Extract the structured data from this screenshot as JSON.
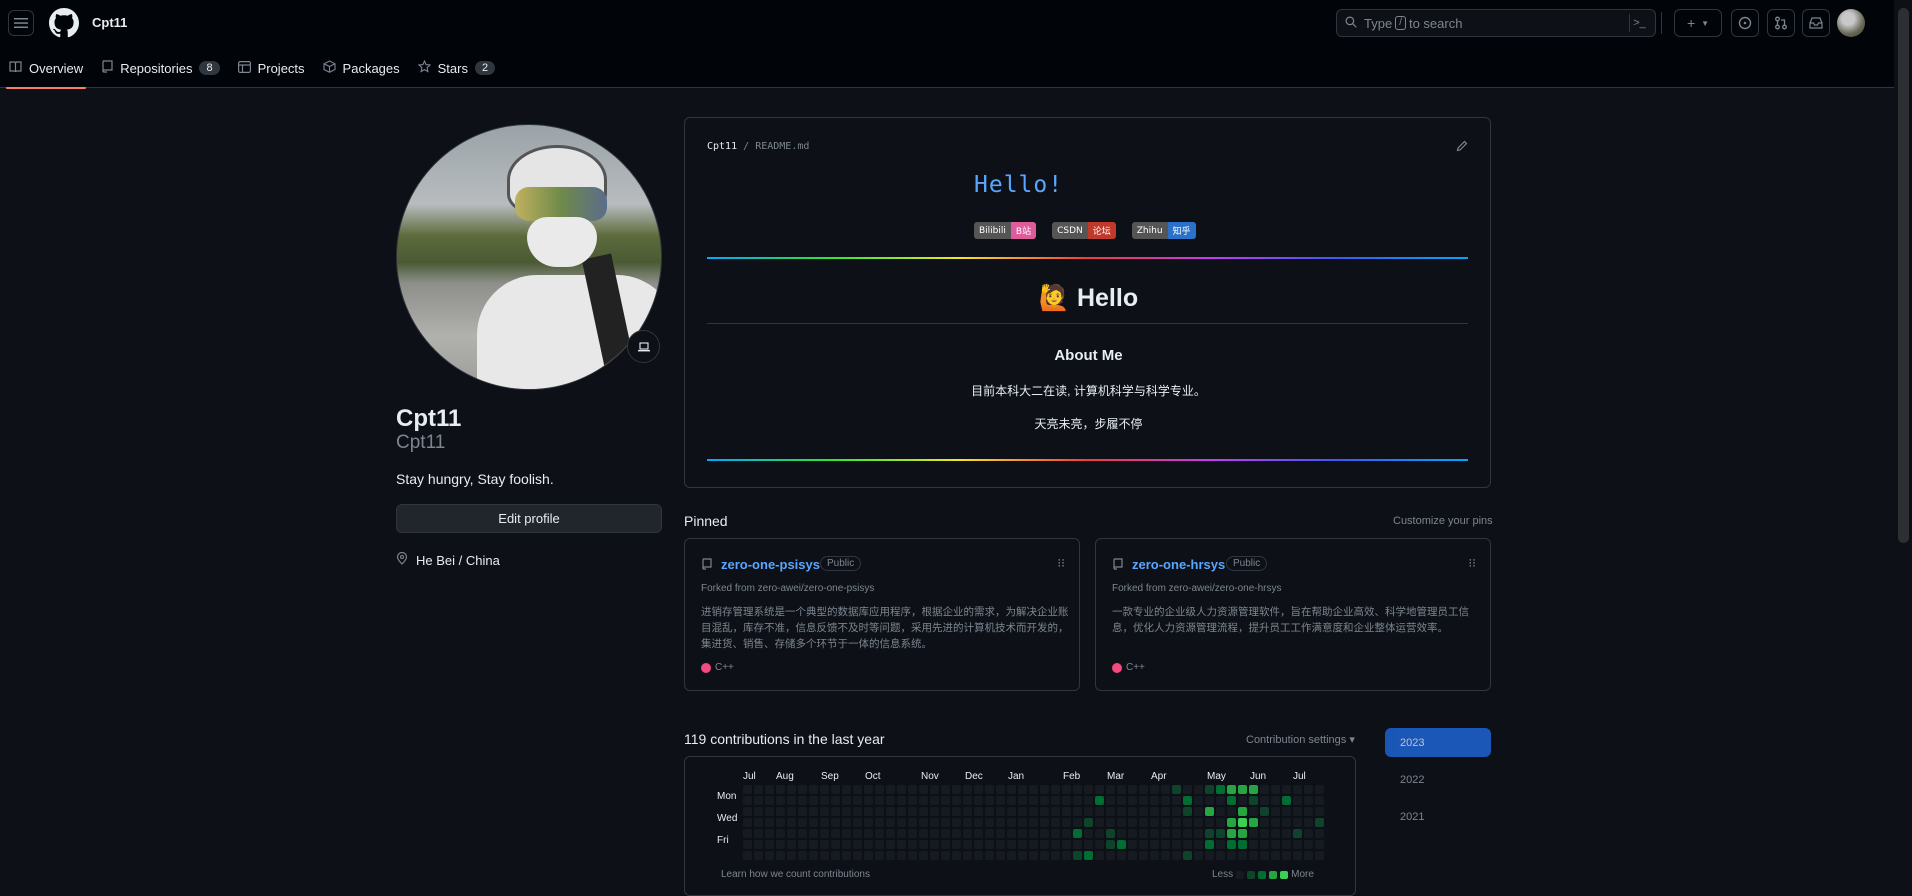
{
  "topbar": {
    "username": "Cpt11",
    "search_prefix": "Type",
    "search_key": "/",
    "search_suffix": "to search",
    "new_label": "+"
  },
  "nav": {
    "tabs": [
      {
        "label": "Overview",
        "icon": "book-icon",
        "active": true
      },
      {
        "label": "Repositories",
        "icon": "repo-icon",
        "count": "8"
      },
      {
        "label": "Projects",
        "icon": "table-icon"
      },
      {
        "label": "Packages",
        "icon": "package-icon"
      },
      {
        "label": "Stars",
        "icon": "star-icon",
        "count": "2"
      }
    ]
  },
  "profile": {
    "name": "Cpt11",
    "login": "Cpt11",
    "bio": "Stay hungry, Stay foolish.",
    "edit_label": "Edit profile",
    "location": "He Bei / China"
  },
  "readme": {
    "owner": "Cpt11",
    "sep": "/",
    "file": "README.md",
    "hello_mono": "Hello!",
    "badges": [
      {
        "left": "Bilibili",
        "right": "B站",
        "color": "#e05b9c"
      },
      {
        "left": "CSDN",
        "right": "论坛",
        "color": "#c0392b"
      },
      {
        "left": "Zhihu",
        "right": "知乎",
        "color": "#2a72c9"
      }
    ],
    "heading": "🙋 Hello",
    "about_title": "About Me",
    "about_line1": "目前本科大二在读, 计算机科学与科学专业。",
    "about_line2": "天亮未亮，步履不停"
  },
  "pinned": {
    "title": "Pinned",
    "customize": "Customize your pins",
    "items": [
      {
        "name": "zero-one-psisys",
        "visibility": "Public",
        "fork": "Forked from zero-awei/zero-one-psisys",
        "desc": "进销存管理系统是一个典型的数据库应用程序，根据企业的需求，为解决企业账目混乱，库存不准，信息反馈不及时等问题，采用先进的计算机技术而开发的，集进货、销售、存储多个环节于一体的信息系统。",
        "lang": "C++",
        "lang_color": "#f34b7d"
      },
      {
        "name": "zero-one-hrsys",
        "visibility": "Public",
        "fork": "Forked from zero-awei/zero-one-hrsys",
        "desc": "一款专业的企业级人力资源管理软件，旨在帮助企业高效、科学地管理员工信息，优化人力资源管理流程，提升员工工作满意度和企业整体运营效率。",
        "lang": "C++",
        "lang_color": "#f34b7d"
      }
    ]
  },
  "contributions": {
    "title": "119 contributions in the last year",
    "settings": "Contribution settings ▾",
    "months": [
      "Jul",
      "Aug",
      "Sep",
      "Oct",
      "Nov",
      "Dec",
      "Jan",
      "Feb",
      "Mar",
      "Apr",
      "May",
      "Jun",
      "Jul"
    ],
    "days": [
      "Mon",
      "Wed",
      "Fri"
    ],
    "learn": "Learn how we count contributions",
    "less": "Less",
    "more": "More",
    "years": [
      "2023",
      "2022",
      "2021"
    ],
    "selected_year": "2023",
    "level_colors": [
      "#161b22",
      "#0e4429",
      "#006d32",
      "#26a641",
      "#39d353"
    ]
  }
}
